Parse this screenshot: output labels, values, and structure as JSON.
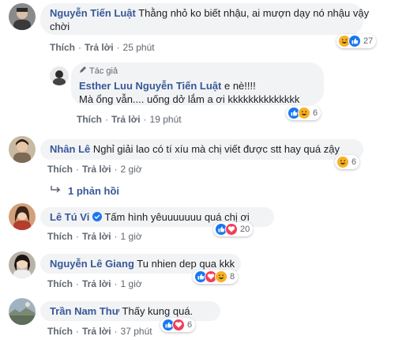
{
  "comments": [
    {
      "name": "Nguyễn Tiến Luật",
      "text": "Thằng nhỏ ko biết nhậu, ai mượn dạy nó nhậu vậy",
      "text2": "chời",
      "like": "Thích",
      "reply": "Trả lời",
      "time": "25 phút",
      "count": "27"
    },
    {
      "author_tag": "Tác giả",
      "name": "Esther Luu",
      "mention": "Nguyễn Tiến Luật",
      "text": "e nè!!!!",
      "text2": "Mà ổng vẫn.... uống dở lắm a ơi kkkkkkkkkkkkkk",
      "like": "Thích",
      "reply": "Trả lời",
      "time": "19 phút",
      "count": "6"
    },
    {
      "name": "Nhân Lê",
      "text": "Nghỉ giải lao có tí xíu mà chị viết được stt hay quá zậy",
      "like": "Thích",
      "reply": "Trả lời",
      "time": "2 giờ",
      "count": "6",
      "replies": "1 phản hồi"
    },
    {
      "name": "Lê Tú Vi",
      "text": "Tấm hình yêuuuuuuu quá chị ơi",
      "like": "Thích",
      "reply": "Trả lời",
      "time": "1 giờ",
      "count": "20"
    },
    {
      "name": "Nguyễn Lê Giang",
      "text": "Tu nhien dep qua kkk",
      "like": "Thích",
      "reply": "Trả lời",
      "time": "1 giờ",
      "count": "8"
    },
    {
      "name": "Trần Nam Thư",
      "text": "Thấy kung quá.",
      "like": "Thích",
      "reply": "Trả lời",
      "time": "37 phút",
      "count": "6"
    }
  ],
  "colors": {
    "link": "#385898",
    "bubble": "#f2f3f5",
    "like": "#1877f2",
    "love": "#f33e58",
    "haha": "#f7b125"
  },
  "icons": [
    "haha-icon",
    "like-icon",
    "love-icon",
    "verified-icon",
    "reply-arrow-icon",
    "pencil-icon"
  ]
}
